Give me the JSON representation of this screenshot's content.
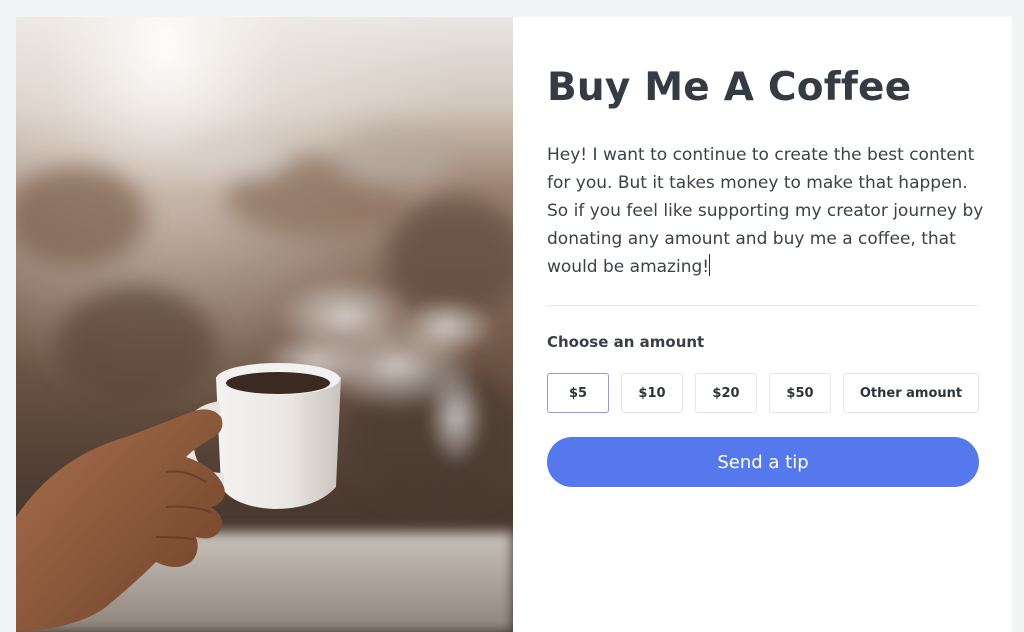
{
  "card": {
    "title": "Buy Me A Coffee",
    "description": "Hey! I want to continue to create the best content for you. But it takes money to make that happen. So if you feel like supporting my creator journey by donating any amount and buy me a coffee, that would be amazing!",
    "choose_label": "Choose an amount",
    "amounts": [
      {
        "label": "$5",
        "selected": true
      },
      {
        "label": "$10",
        "selected": false
      },
      {
        "label": "$20",
        "selected": false
      },
      {
        "label": "$50",
        "selected": false
      },
      {
        "label": "Other amount",
        "selected": false
      }
    ],
    "submit_label": "Send a tip"
  },
  "colors": {
    "page_background": "#f3f4f6",
    "card_background": "#ffffff",
    "title": "#353b43",
    "body_text": "#3c4249",
    "accent_button": "#5579ed",
    "selected_border": "#8f97e6",
    "button_border": "#e3e5e8"
  },
  "photo": {
    "subject": "hand holding steaming white coffee mug outdoors"
  }
}
